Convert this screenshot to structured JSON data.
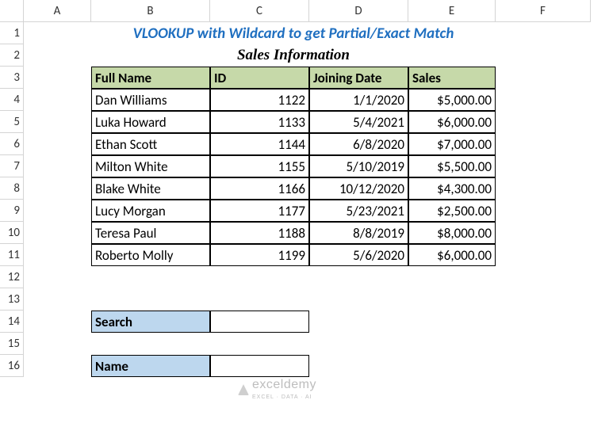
{
  "columns": [
    "",
    "A",
    "B",
    "C",
    "D",
    "E",
    "F"
  ],
  "rowNumbers": [
    "1",
    "2",
    "3",
    "4",
    "5",
    "6",
    "7",
    "8",
    "9",
    "10",
    "11",
    "12",
    "13",
    "14",
    "15",
    "16"
  ],
  "title": "VLOOKUP with Wildcard to get Partial/Exact Match",
  "subtitle": "Sales Information",
  "headers": {
    "name": "Full Name",
    "id": "ID",
    "join": "Joining Date",
    "sales": "Sales"
  },
  "rows": [
    {
      "name": "Dan Williams",
      "id": "1122",
      "join": "1/1/2020",
      "sales": "$5,000.00"
    },
    {
      "name": "Luka Howard",
      "id": "1133",
      "join": "5/4/2021",
      "sales": "$6,000.00"
    },
    {
      "name": "Ethan Scott",
      "id": "1144",
      "join": "6/8/2020",
      "sales": "$7,000.00"
    },
    {
      "name": "Milton White",
      "id": "1155",
      "join": "5/10/2019",
      "sales": "$5,500.00"
    },
    {
      "name": "Blake White",
      "id": "1166",
      "join": "10/12/2020",
      "sales": "$4,300.00"
    },
    {
      "name": "Lucy Morgan",
      "id": "1177",
      "join": "5/23/2021",
      "sales": "$2,500.00"
    },
    {
      "name": "Teresa Paul",
      "id": "1188",
      "join": "8/8/2019",
      "sales": "$8,000.00"
    },
    {
      "name": "Roberto Molly",
      "id": "1199",
      "join": "5/6/2020",
      "sales": "$6,000.00"
    }
  ],
  "search": {
    "label": "Search",
    "value": ""
  },
  "nameLookup": {
    "label": "Name",
    "value": ""
  },
  "watermark": {
    "brand": "exceldemy",
    "tagline": "EXCEL · DATA · AI"
  }
}
